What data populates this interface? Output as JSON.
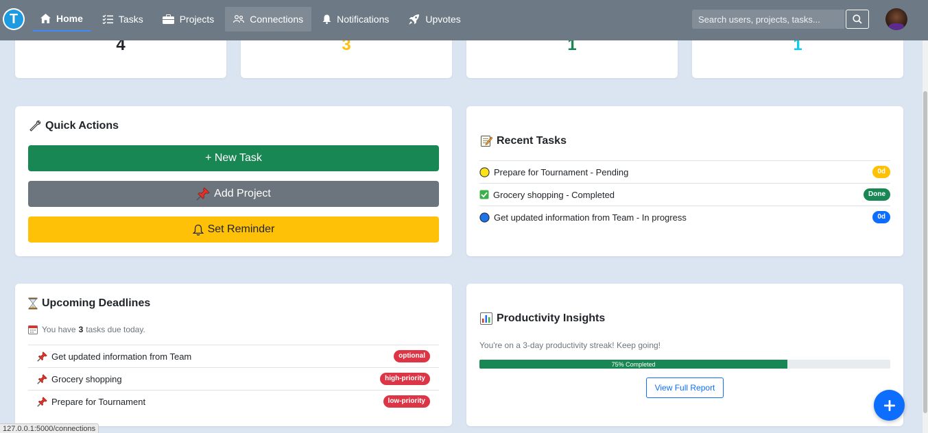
{
  "navbar": {
    "logo_letter": "T",
    "items": [
      {
        "label": "Home",
        "icon": "home-icon"
      },
      {
        "label": "Tasks",
        "icon": "list-check-icon"
      },
      {
        "label": "Projects",
        "icon": "briefcase-icon"
      },
      {
        "label": "Connections",
        "icon": "people-icon"
      },
      {
        "label": "Notifications",
        "icon": "bell-icon"
      },
      {
        "label": "Upvotes",
        "icon": "rocket-icon"
      }
    ],
    "active_item": "Home",
    "hover_item": "Connections",
    "search_placeholder": "Search users, projects, tasks..."
  },
  "stats": [
    {
      "value": "4",
      "color": "#212529"
    },
    {
      "value": "3",
      "color": "#ffc107"
    },
    {
      "value": "1",
      "color": "#198754"
    },
    {
      "value": "1",
      "color": "#0dcaf0"
    }
  ],
  "quick_actions": {
    "title": "Quick Actions",
    "new_task": "+ New Task",
    "add_project": "Add Project",
    "set_reminder": "Set Reminder",
    "colors": {
      "new_task": "#198754",
      "add_project": "#6c757d",
      "set_reminder": "#ffc107"
    }
  },
  "recent_tasks": {
    "title": "Recent Tasks",
    "items": [
      {
        "text": "Prepare for Tournament - Pending",
        "status_icon": "yellow-circle-icon",
        "badge": "0d",
        "badge_color": "#ffc107"
      },
      {
        "text": "Grocery shopping - Completed",
        "status_icon": "check-box-icon",
        "badge": "Done",
        "badge_color": "#198754"
      },
      {
        "text": "Get updated information from Team - In progress",
        "status_icon": "blue-circle-icon",
        "badge": "0d",
        "badge_color": "#0d6efd"
      }
    ]
  },
  "deadlines": {
    "title": "Upcoming Deadlines",
    "info_prefix": "You have",
    "info_count": "3",
    "info_suffix": "tasks due today.",
    "items": [
      {
        "text": "Get updated information from Team",
        "badge": "optional",
        "badge_color": "#dc3545"
      },
      {
        "text": "Grocery shopping",
        "badge": "high-priority",
        "badge_color": "#dc3545"
      },
      {
        "text": "Prepare for Tournament",
        "badge": "low-priority",
        "badge_color": "#dc3545"
      }
    ]
  },
  "insights": {
    "title": "Productivity Insights",
    "streak": "You're on a 3-day productivity streak! Keep going!",
    "progress_percent": 75,
    "progress_label": "75% Completed",
    "report_button": "View Full Report"
  },
  "fab_icon": "plus-icon",
  "status_url": "127.0.0.1:5000/connections"
}
